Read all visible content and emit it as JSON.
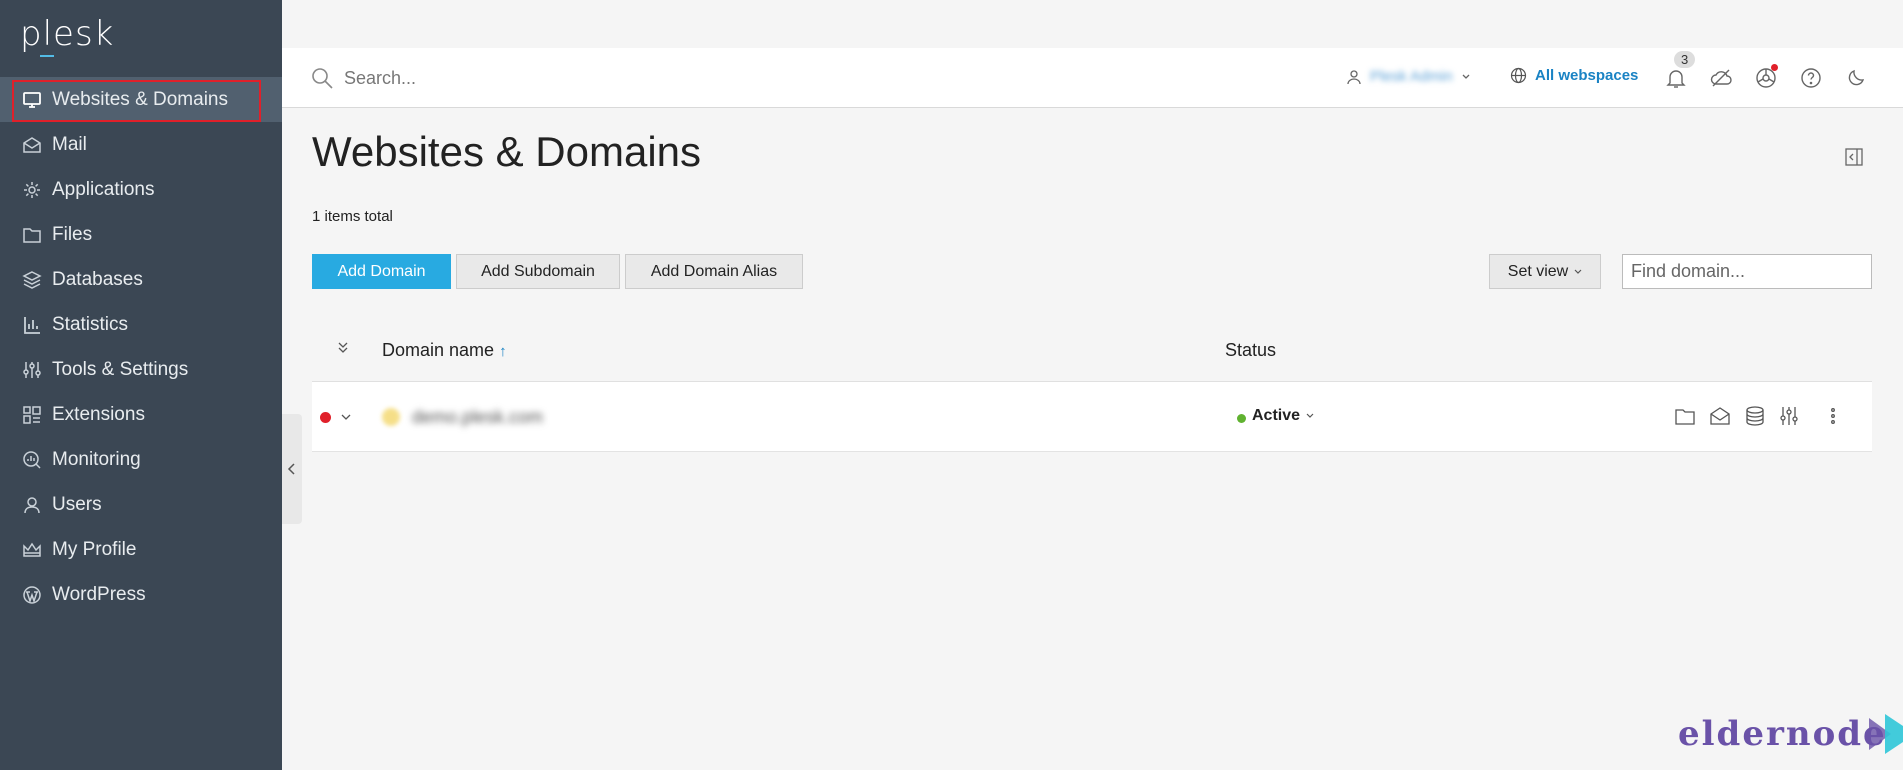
{
  "brand": {
    "logo": "plesk"
  },
  "sidebar": {
    "items": [
      {
        "label": "Websites & Domains",
        "icon": "monitor-icon",
        "active": true
      },
      {
        "label": "Mail",
        "icon": "envelope-icon"
      },
      {
        "label": "Applications",
        "icon": "gear-icon"
      },
      {
        "label": "Files",
        "icon": "folder-icon"
      },
      {
        "label": "Databases",
        "icon": "layers-icon"
      },
      {
        "label": "Statistics",
        "icon": "bar-chart-icon"
      },
      {
        "label": "Tools & Settings",
        "icon": "sliders-icon"
      },
      {
        "label": "Extensions",
        "icon": "extensions-icon"
      },
      {
        "label": "Monitoring",
        "icon": "monitoring-icon"
      },
      {
        "label": "Users",
        "icon": "user-icon"
      },
      {
        "label": "My Profile",
        "icon": "crown-icon"
      },
      {
        "label": "WordPress",
        "icon": "wordpress-icon"
      }
    ]
  },
  "header": {
    "search_placeholder": "Search...",
    "user_name": "Plesk Admin",
    "webspaces_label": "All webspaces",
    "notifications_count": "3"
  },
  "main": {
    "title": "Websites & Domains",
    "items_total": "1 items total",
    "buttons": {
      "add_domain": "Add Domain",
      "add_subdomain": "Add Subdomain",
      "add_alias": "Add Domain Alias",
      "set_view": "Set view"
    },
    "find_placeholder": "Find domain...",
    "table": {
      "col_domain": "Domain name",
      "col_domain_sort": "↑",
      "col_status": "Status",
      "rows": [
        {
          "domain": "demo.plesk.com",
          "status": "Active"
        }
      ]
    }
  },
  "watermark": {
    "text": "eldernode"
  },
  "colors": {
    "accent": "#28aae1",
    "sidebar": "#3b4754",
    "highlight": "#e0202a",
    "active": "#60b230"
  }
}
